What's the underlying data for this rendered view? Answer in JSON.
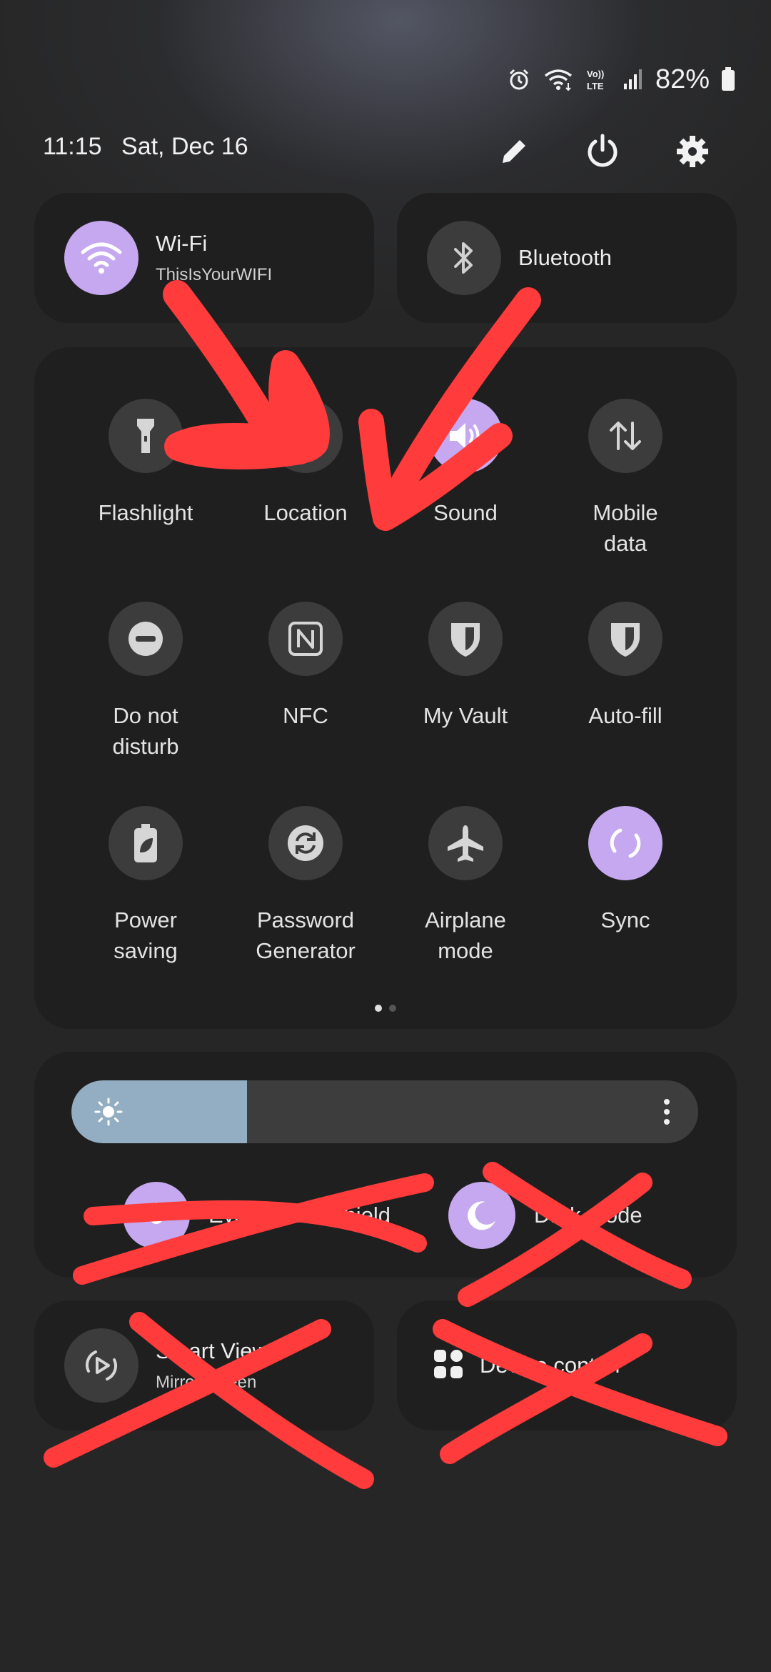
{
  "status_bar": {
    "battery_percent": "82%",
    "icons": [
      "alarm-icon",
      "wifi-icon",
      "volte-icon",
      "signal-icon",
      "battery-icon"
    ],
    "volte_text": "Vo))\nLTE"
  },
  "header": {
    "time": "11:15",
    "date": "Sat, Dec 16",
    "icons": [
      "edit-icon",
      "power-icon",
      "settings-icon"
    ]
  },
  "big_tiles": {
    "wifi": {
      "title": "Wi-Fi",
      "subtitle": "ThisIsYourWIFI",
      "on": true
    },
    "bluetooth": {
      "title": "Bluetooth",
      "on": false
    }
  },
  "quick_tiles": [
    {
      "label": "Flashlight",
      "icon": "flashlight-icon",
      "on": false
    },
    {
      "label": "Location",
      "icon": "location-icon",
      "on": false
    },
    {
      "label": "Sound",
      "icon": "sound-icon",
      "on": true
    },
    {
      "label": "Mobile\ndata",
      "icon": "mobile-data-icon",
      "on": false
    },
    {
      "label": "Do not\ndisturb",
      "icon": "do-not-disturb-icon",
      "on": false
    },
    {
      "label": "NFC",
      "icon": "nfc-icon",
      "on": false
    },
    {
      "label": "My Vault",
      "icon": "shield-icon",
      "on": false
    },
    {
      "label": "Auto-fill",
      "icon": "shield-icon",
      "on": false
    },
    {
      "label": "Power\nsaving",
      "icon": "battery-leaf-icon",
      "on": false
    },
    {
      "label": "Password\nGenerator",
      "icon": "refresh-icon",
      "on": false
    },
    {
      "label": "Airplane\nmode",
      "icon": "airplane-icon",
      "on": false
    },
    {
      "label": "Sync",
      "icon": "sync-icon",
      "on": true
    }
  ],
  "page_indicator": {
    "pages": 2,
    "current": 1
  },
  "brightness": {
    "level": 0.28,
    "icon": "sun-icon",
    "menu_icon": "more-vertical-icon"
  },
  "toggles": {
    "eye_comfort": {
      "label": "Eye comfort shield",
      "icon": "eye-comfort-icon"
    },
    "dark_mode": {
      "label": "Dark mode",
      "icon": "moon-icon"
    }
  },
  "bottom_tiles": {
    "smart_view": {
      "title": "Smart View",
      "subtitle": "Mirror screen",
      "icon": "smart-view-icon"
    },
    "device_control": {
      "title": "Device control",
      "icon": "grid-icon"
    }
  },
  "colors": {
    "accent": "#c5a8ef",
    "tile_bg": "#1f1f1f",
    "circle_off": "#3c3c3c",
    "brightness_fill": "#93aec2",
    "annotation_red": "#ff3b3b"
  }
}
